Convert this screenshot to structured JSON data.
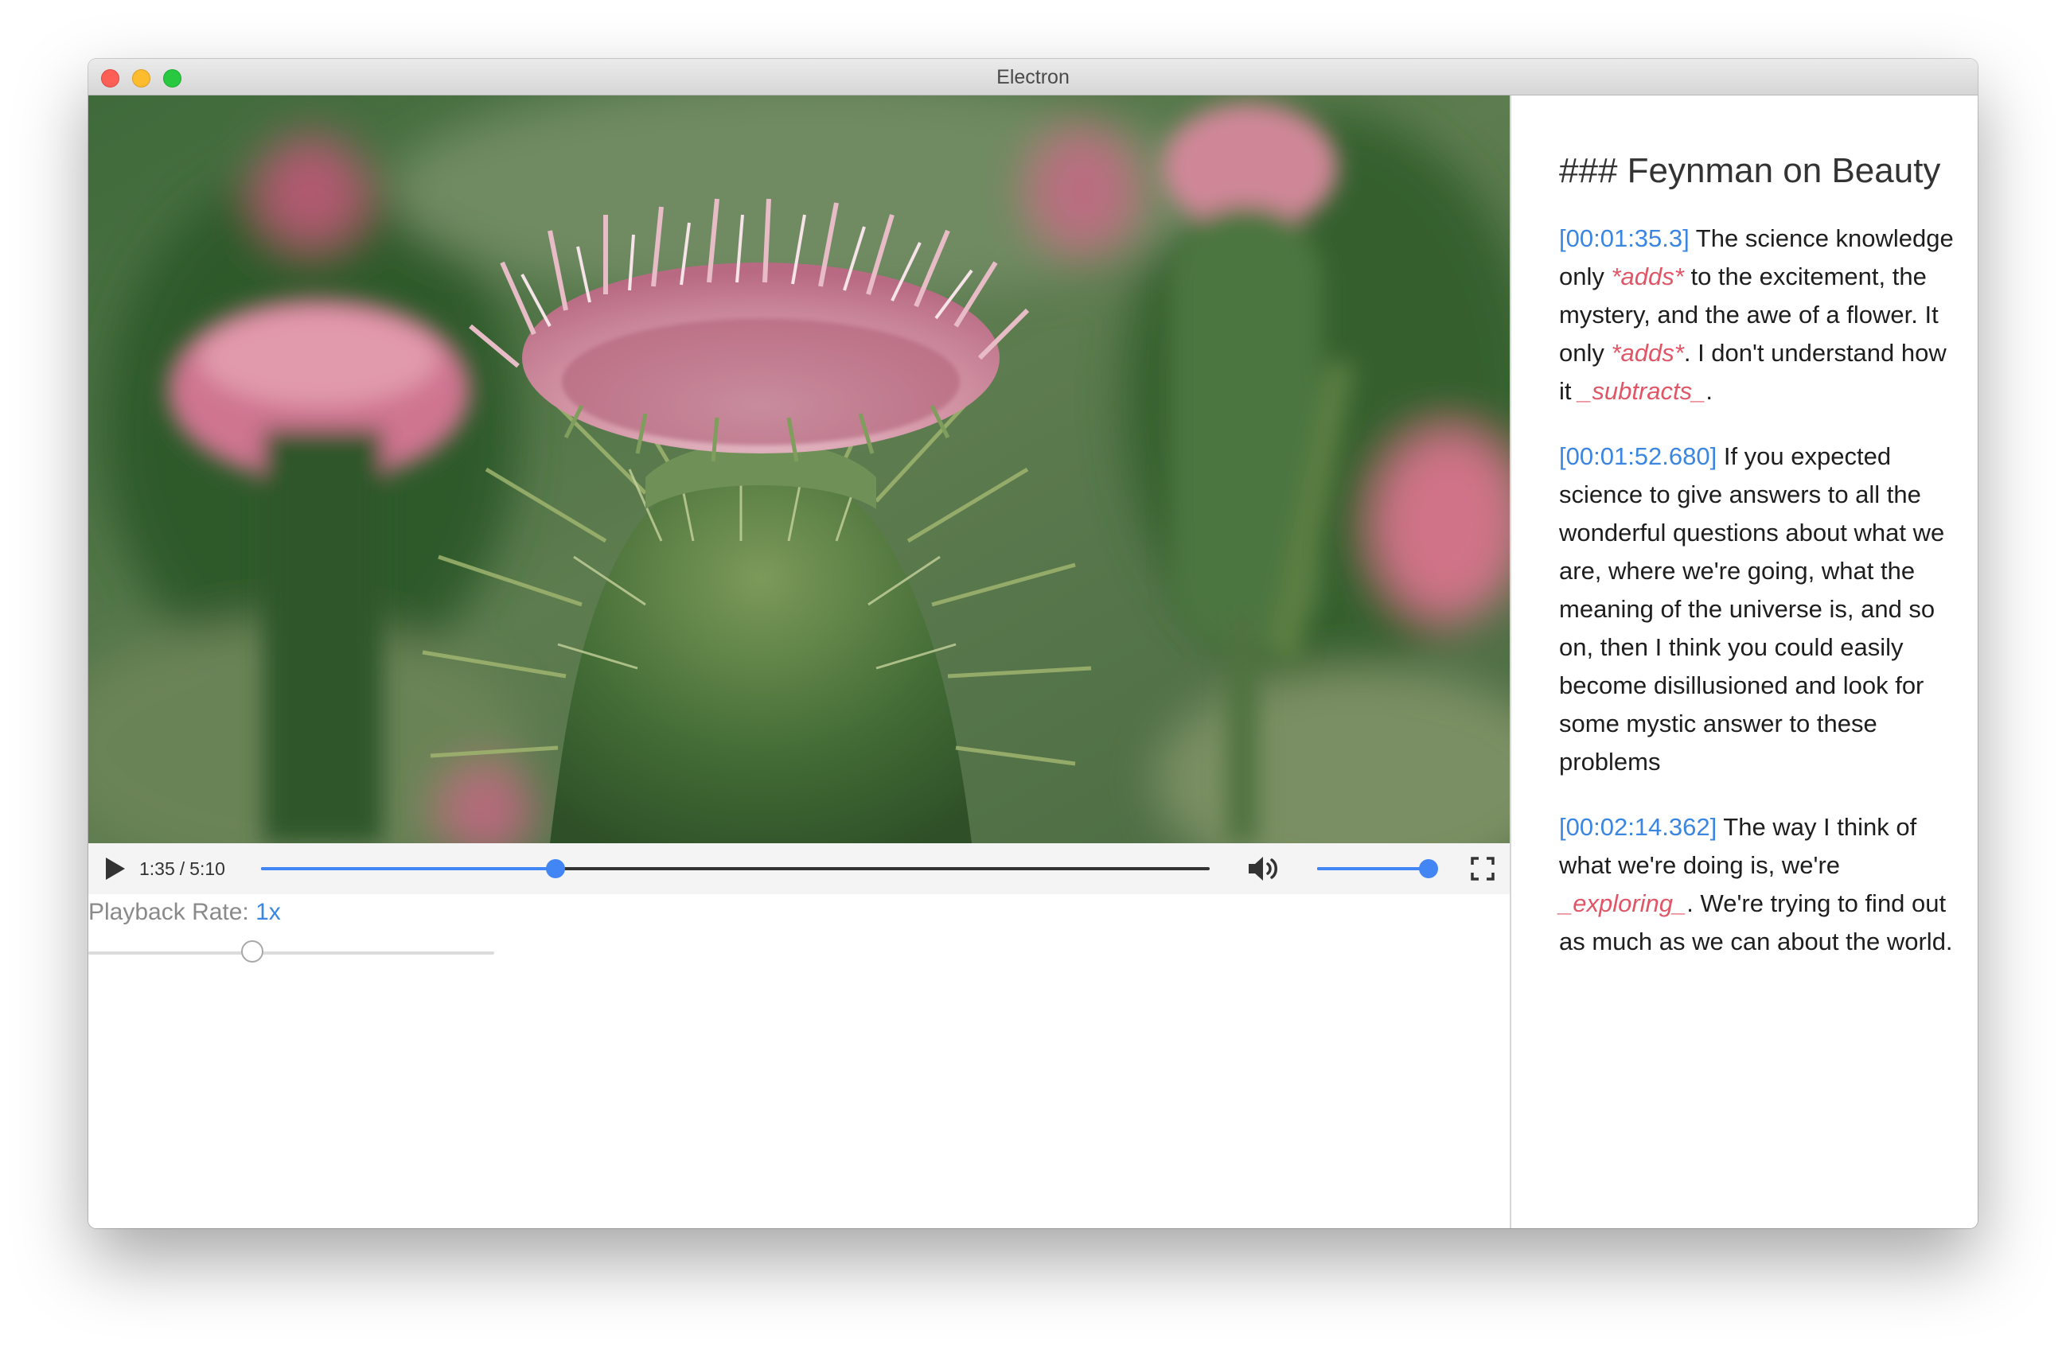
{
  "window": {
    "title": "Electron"
  },
  "player": {
    "current_time": "1:35",
    "separator": "/",
    "duration": "5:10",
    "progress_fraction": 0.31,
    "volume_fraction": 1.0,
    "play_icon": "play-icon",
    "volume_icon": "volume-icon",
    "fullscreen_icon": "fullscreen-icon"
  },
  "playback_rate": {
    "label": "Playback Rate:",
    "value": "1x"
  },
  "notes": {
    "heading": "### Feynman on Beauty",
    "paragraphs": [
      {
        "timestamp": "[00:01:35.3]",
        "t1": " The science knowledge only ",
        "e1": "*adds*",
        "t2": " to the excitement, the mystery, and the awe of a flower. It only ",
        "e2": "*adds*",
        "t3": ". I don't understand how it ",
        "e3": "_subtracts_",
        "t4": "."
      },
      {
        "timestamp": "[00:01:52.680]",
        "t1": " If you expected science to give answers to all the wonderful questions about what we are, where we're going, what the meaning of the universe is, and so on, then I think you could easily become disillusioned and look for some mystic answer to these problems"
      },
      {
        "timestamp": "[00:02:14.362]",
        "t1": " The way I think of what we're doing is, we're ",
        "e1": "_exploring_",
        "t2": ". We're trying to find out as much as we can about the world."
      }
    ]
  },
  "colors": {
    "accent_blue": "#4285f4",
    "timestamp_blue": "#3a86e0",
    "emphasis_red": "#e05667"
  }
}
